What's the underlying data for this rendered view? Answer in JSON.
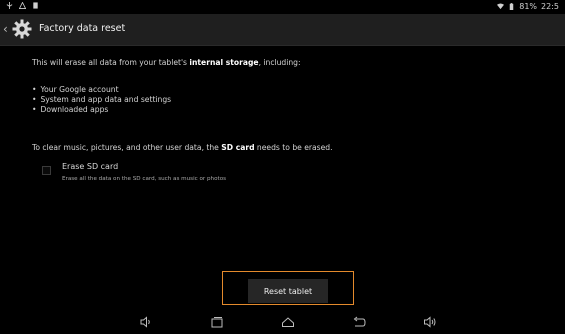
{
  "status_bar": {
    "battery": "81%",
    "time": "22:5"
  },
  "action_bar": {
    "title": "Factory data reset"
  },
  "content": {
    "intro_prefix": "This will erase all data from your tablet's ",
    "intro_bold": "internal storage",
    "intro_suffix": ", including:",
    "bullets": [
      "Your Google account",
      "System and app data and settings",
      "Downloaded apps"
    ],
    "clear_prefix": "To clear music, pictures, and other user data, the ",
    "clear_bold": "SD card",
    "clear_suffix": " needs to be erased."
  },
  "erase_sd": {
    "label": "Erase SD card",
    "description": "Erase all the data on the SD card, such as music or photos",
    "checked": false
  },
  "reset_button": {
    "label": "Reset tablet"
  },
  "colors": {
    "accent_highlight": "#e48a2c",
    "background": "#000000",
    "action_bar": "#1f1f1f"
  },
  "nav_icons": [
    "volume-down-icon",
    "recent-apps-icon",
    "home-icon",
    "back-icon",
    "volume-up-icon"
  ]
}
